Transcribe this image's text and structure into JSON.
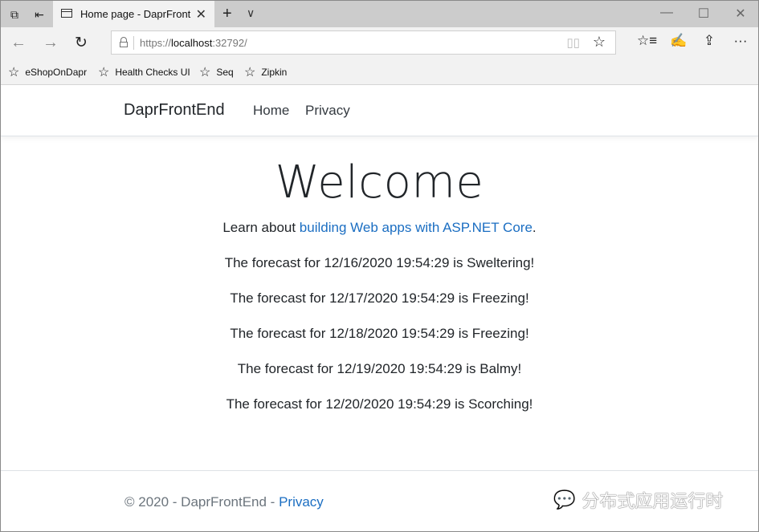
{
  "browser": {
    "tab": {
      "title": "Home page - DaprFront",
      "close_icon": "close-icon"
    },
    "tab_strip": {
      "new_tab_icon": "+",
      "tab_list_icon": "∨"
    },
    "window_controls": {
      "minimize": "—",
      "maximize": "☐",
      "close": "✕"
    },
    "nav": {
      "back": "←",
      "forward": "→",
      "refresh": "↻"
    },
    "address": {
      "scheme": "https://",
      "host": "localhost",
      "port": ":32792/"
    },
    "address_icons": {
      "reading_view": "📖",
      "favorite": "☆"
    },
    "toolbar": {
      "favorites_hub": "☆≡",
      "notes": "✍",
      "share": "⇪",
      "more": "···"
    },
    "favorites": [
      {
        "label": "eShopOnDapr"
      },
      {
        "label": "Health Checks UI"
      },
      {
        "label": "Seq"
      },
      {
        "label": "Zipkin"
      }
    ]
  },
  "site": {
    "brand": "DaprFrontEnd",
    "nav": [
      {
        "label": "Home"
      },
      {
        "label": "Privacy"
      }
    ],
    "heading": "Welcome",
    "learn_prefix": "Learn about ",
    "learn_link": "building Web apps with ASP.NET Core",
    "learn_suffix": ".",
    "forecasts": [
      "The forecast for 12/16/2020 19:54:29 is Sweltering!",
      "The forecast for 12/17/2020 19:54:29 is Freezing!",
      "The forecast for 12/18/2020 19:54:29 is Freezing!",
      "The forecast for 12/19/2020 19:54:29 is Balmy!",
      "The forecast for 12/20/2020 19:54:29 is Scorching!"
    ],
    "footer": {
      "copyright": "© 2020 - DaprFrontEnd - ",
      "privacy_link": "Privacy"
    }
  },
  "watermark": {
    "text": "分布式应用运行时"
  },
  "colors": {
    "link": "#1b6ec2",
    "text": "#212529",
    "muted": "#6c757d",
    "tabstrip": "#cccccc",
    "toolbar": "#f2f2f2"
  }
}
